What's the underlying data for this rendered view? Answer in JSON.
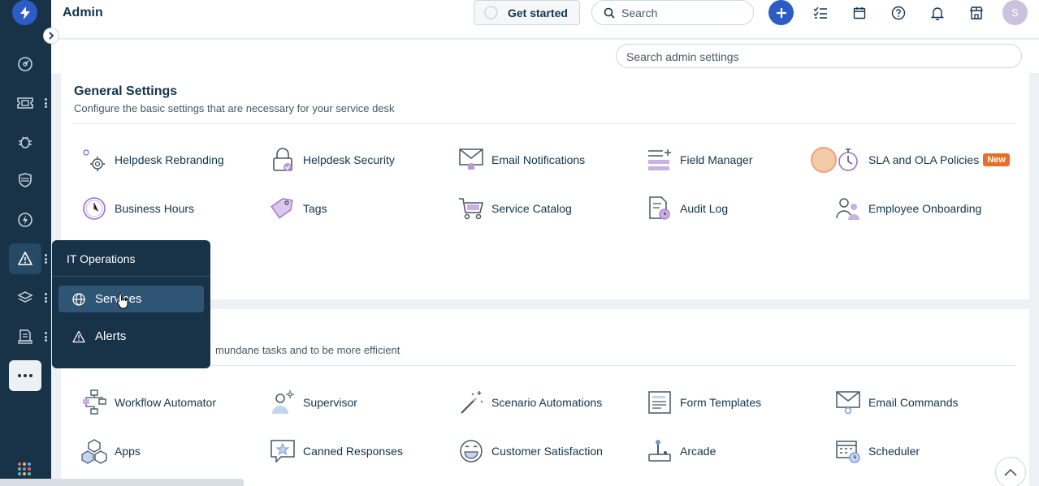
{
  "header": {
    "title": "Admin",
    "get_started_label": "Get started",
    "search_placeholder": "Search",
    "avatar_initial": "S"
  },
  "subheader": {
    "admin_search_placeholder": "Search admin settings"
  },
  "sections": {
    "general": {
      "title": "General Settings",
      "subtitle": "Configure the basic settings that are necessary for your service desk",
      "items": [
        {
          "label": "Helpdesk Rebranding",
          "icon": "gear-person-icon"
        },
        {
          "label": "Helpdesk Security",
          "icon": "lock-icon"
        },
        {
          "label": "Email Notifications",
          "icon": "envelope-bell-icon"
        },
        {
          "label": "Field Manager",
          "icon": "list-icon"
        },
        {
          "label": "SLA and OLA Policies",
          "icon": "stopwatch-icon",
          "badge": "New"
        },
        {
          "label": "Business Hours",
          "icon": "clock-icon"
        },
        {
          "label": "Tags",
          "icon": "tag-icon"
        },
        {
          "label": "Service Catalog",
          "icon": "cart-icon"
        },
        {
          "label": "Audit Log",
          "icon": "document-clock-icon"
        },
        {
          "label": "Employee Onboarding",
          "icon": "users-icon"
        }
      ]
    },
    "automation": {
      "subtitle_partial": "mundane tasks and to be more efficient",
      "items": [
        {
          "label": "Workflow Automator",
          "icon": "workflow-icon"
        },
        {
          "label": "Supervisor",
          "icon": "supervisor-icon"
        },
        {
          "label": "Scenario Automations",
          "icon": "magic-wand-icon"
        },
        {
          "label": "Form Templates",
          "icon": "form-icon"
        },
        {
          "label": "Email Commands",
          "icon": "envelope-at-icon"
        },
        {
          "label": "Apps",
          "icon": "cubes-icon"
        },
        {
          "label": "Canned Responses",
          "icon": "chat-star-icon"
        },
        {
          "label": "Customer Satisfaction",
          "icon": "smiley-icon"
        },
        {
          "label": "Arcade",
          "icon": "joystick-icon"
        },
        {
          "label": "Scheduler",
          "icon": "calendar-clock-icon"
        }
      ]
    }
  },
  "flyout": {
    "title": "IT Operations",
    "items": [
      {
        "label": "Services",
        "icon": "globe-icon",
        "active": true
      },
      {
        "label": "Alerts",
        "icon": "alert-icon",
        "active": false
      }
    ]
  },
  "colors": {
    "nav_bg": "#183247",
    "primary": "#2c5cc5",
    "badge_new": "#e86f25",
    "icon_accent": "#9c72c9"
  }
}
